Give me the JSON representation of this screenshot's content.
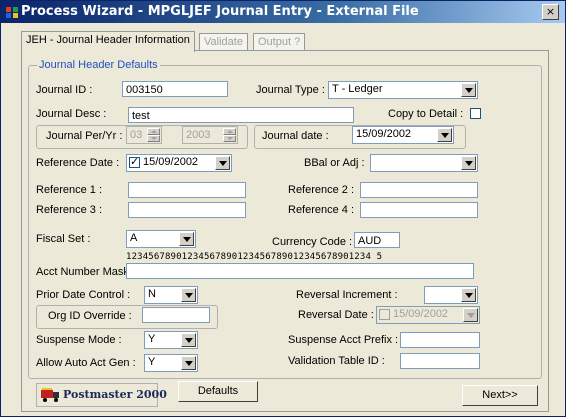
{
  "window": {
    "title": "Process Wizard - MPGLJEF Journal Entry - External File",
    "close_label": "×"
  },
  "tabs": [
    {
      "label": "JEH - Journal Header Information"
    },
    {
      "label": "Validate"
    },
    {
      "label": "Output ?"
    }
  ],
  "group": {
    "legend": "Journal Header Defaults"
  },
  "fields": {
    "journal_id": {
      "label": "Journal ID :",
      "value": "003150"
    },
    "journal_type": {
      "label": "Journal Type :",
      "value": "T - Ledger"
    },
    "journal_desc": {
      "label": "Journal Desc :",
      "value": "test"
    },
    "copy_to_detail": {
      "label": "Copy to Detail :"
    },
    "journal_per_yr": {
      "label": "Journal Per/Yr :",
      "period": "03",
      "year": "2003"
    },
    "journal_date": {
      "label": "Journal date :",
      "value": "15/09/2002"
    },
    "reference_date": {
      "label": "Reference Date :",
      "value": "15/09/2002"
    },
    "bbal_or_adj": {
      "label": "BBal or Adj :",
      "value": ""
    },
    "reference_1": {
      "label": "Reference 1 :",
      "value": ""
    },
    "reference_2": {
      "label": "Reference 2 :",
      "value": ""
    },
    "reference_3": {
      "label": "Reference 3 :",
      "value": ""
    },
    "reference_4": {
      "label": "Reference 4 :",
      "value": ""
    },
    "fiscal_set": {
      "label": "Fiscal Set :",
      "value": "A"
    },
    "currency_code": {
      "label": "Currency Code :",
      "value": "AUD"
    },
    "acct_number_mask": {
      "label": "Acct Number Mask :",
      "ruler": "12345678901234567890123456789012345678901234 5",
      "value": ""
    },
    "prior_date_control": {
      "label": "Prior Date Control :",
      "value": "N"
    },
    "reversal_increment": {
      "label": "Reversal Increment :",
      "value": ""
    },
    "org_id_override": {
      "label": "Org ID Override :",
      "value": ""
    },
    "reversal_date": {
      "label": "Reversal Date :",
      "value": "15/09/2002"
    },
    "suspense_mode": {
      "label": "Suspense Mode :",
      "value": "Y"
    },
    "suspense_acct_prefix": {
      "label": "Suspense Acct Prefix :",
      "value": ""
    },
    "allow_auto_act_gen": {
      "label": "Allow Auto Act Gen :",
      "value": "Y"
    },
    "validation_table_id": {
      "label": "Validation Table ID :",
      "value": ""
    }
  },
  "footer": {
    "logo_text": "Postmaster 2000",
    "defaults_button": "Defaults",
    "next_button": "Next>>"
  },
  "colors": {
    "title_start": "#0a246a",
    "title_end": "#a6caf0",
    "dialog_bg": "#ece9d8",
    "legend_text": "#2050c0"
  }
}
